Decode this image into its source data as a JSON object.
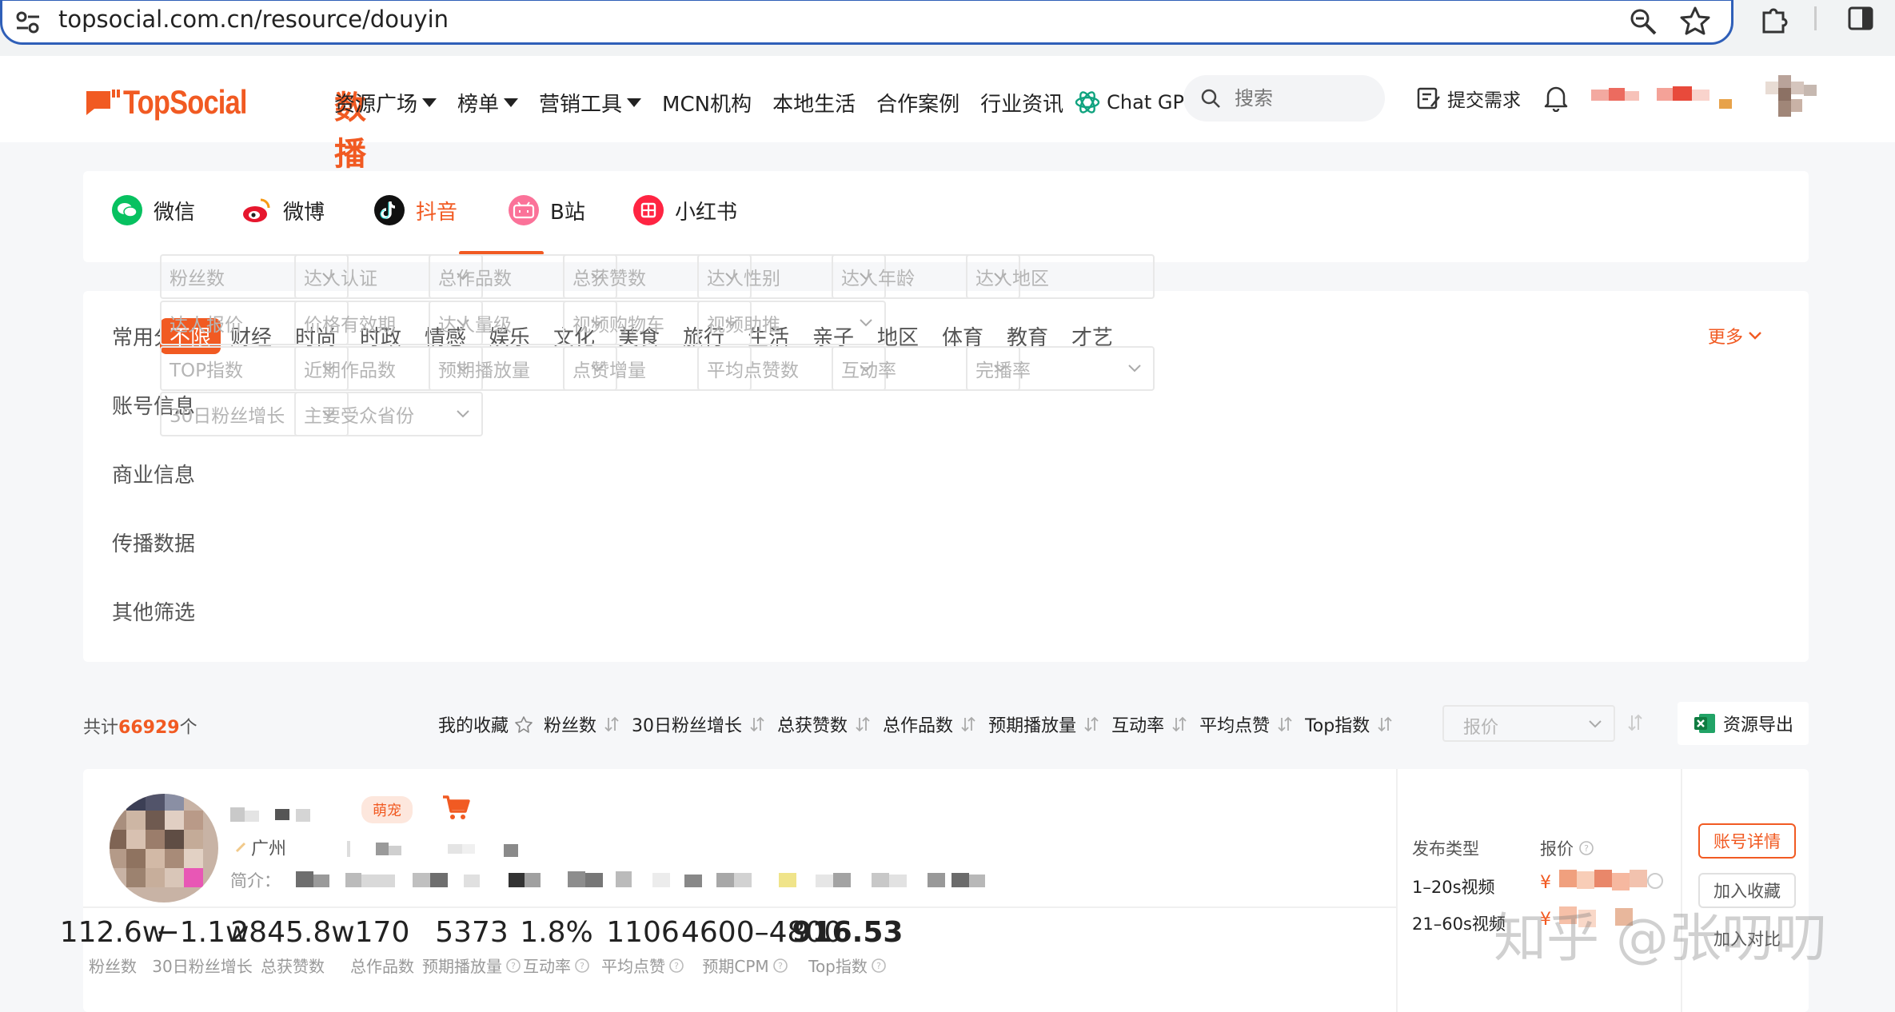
{
  "browser": {
    "url": "topsocial.com.cn/resource/douyin"
  },
  "header": {
    "logo_text": "TopSocial",
    "logo_cn": "数播",
    "nav": [
      {
        "label": "资源广场",
        "dropdown": true
      },
      {
        "label": "榜单",
        "dropdown": true
      },
      {
        "label": "营销工具",
        "dropdown": true
      },
      {
        "label": "MCN机构",
        "dropdown": false
      },
      {
        "label": "本地生活",
        "dropdown": false
      },
      {
        "label": "合作案例",
        "dropdown": false
      },
      {
        "label": "行业资讯",
        "dropdown": false
      }
    ],
    "chatgpt_label": "Chat GPT",
    "search_placeholder": "搜索",
    "submit_need": "提交需求"
  },
  "platforms": [
    {
      "label": "微信",
      "icon": "wechat-icon",
      "color": "#07c160",
      "active": false
    },
    {
      "label": "微博",
      "icon": "weibo-icon",
      "color": "#e6162d",
      "active": false
    },
    {
      "label": "抖音",
      "icon": "douyin-icon",
      "color": "#111111",
      "active": true
    },
    {
      "label": "B站",
      "icon": "bilibili-icon",
      "color": "#fb7299",
      "active": false
    },
    {
      "label": "小红书",
      "icon": "xiaohongshu-icon",
      "color": "#ff2442",
      "active": false
    }
  ],
  "filters": {
    "row_labels": [
      "常用分类",
      "账号信息",
      "商业信息",
      "传播数据",
      "其他筛选"
    ],
    "categories": [
      "不限",
      "财经",
      "时尚",
      "时政",
      "情感",
      "娱乐",
      "文化",
      "美食",
      "旅行",
      "生活",
      "亲子",
      "地区",
      "体育",
      "教育",
      "才艺"
    ],
    "more": "更多",
    "account": [
      "粉丝数",
      "达人认证",
      "总作品数",
      "总获赞数",
      "达人性别",
      "达人年龄",
      "达人地区"
    ],
    "business": [
      "达人报价",
      "价格有效期",
      "达人量级",
      "视频购物车",
      "视频助推"
    ],
    "spread": [
      "TOP指数",
      "近期作品数",
      "预期播放量",
      "点赞增量",
      "平均点赞数",
      "互动率",
      "完播率"
    ],
    "other": [
      "30日粉丝增长",
      "主要受众省份"
    ]
  },
  "sort": {
    "total_prefix": "共计",
    "total_count": "66929",
    "total_suffix": "个",
    "items": [
      "我的收藏",
      "粉丝数",
      "30日粉丝增长",
      "总获赞数",
      "总作品数",
      "预期播放量",
      "互动率",
      "平均点赞",
      "Top指数"
    ],
    "price_placeholder": "报价",
    "export_label": "资源导出"
  },
  "result": {
    "tag": "萌宠",
    "location": "广州",
    "intro_label": "简介：",
    "stats": [
      {
        "value": "112.6w",
        "label": "粉丝数",
        "help": false
      },
      {
        "value": "−1.1w",
        "label": "30日粉丝增长",
        "help": false
      },
      {
        "value": "2845.8w",
        "label": "总获赞数",
        "help": false
      },
      {
        "value": "170",
        "label": "总作品数",
        "help": false
      },
      {
        "value": "5373",
        "label": "预期播放量",
        "help": true
      },
      {
        "value": "1.8%",
        "label": "互动率",
        "help": true
      },
      {
        "value": "1106",
        "label": "平均点赞",
        "help": true
      },
      {
        "value": "4600–4800",
        "label": "预期CPM",
        "help": true
      },
      {
        "value": "916.53",
        "label": "Top指数",
        "help": true
      }
    ],
    "pub_type_header": "发布类型",
    "price_header": "报价",
    "pub_rows": [
      "1–20s视频",
      "21–60s视频"
    ],
    "yen": "¥",
    "btn_detail": "账号详情",
    "btn_fav": "加入收藏",
    "btn_third": "加入对比"
  },
  "watermark": "知乎 @张叨叨",
  "colors": {
    "accent": "#f15a22",
    "focus": "#2f5fb8"
  }
}
